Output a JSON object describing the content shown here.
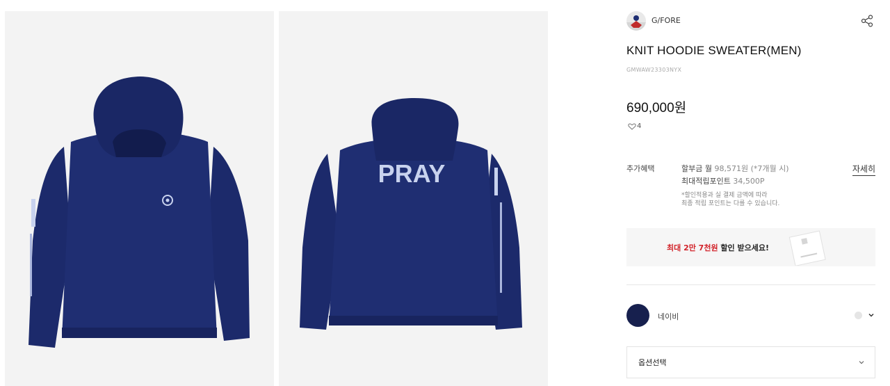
{
  "gallery": {
    "images": [
      {
        "alt": "front-view",
        "back_print": ""
      },
      {
        "alt": "back-view",
        "back_print": "PRAY"
      }
    ]
  },
  "brand": {
    "name": "G/FORE",
    "logo_icon": "brand-avatar-icon"
  },
  "share": {
    "icon": "share-icon"
  },
  "product": {
    "name": "KNIT HOODIE SWEATER(MEN)",
    "code": "GMWAW23303NYX",
    "price": "690,000원",
    "likes": "4"
  },
  "benefits": {
    "label": "추가혜택",
    "installment_prefix": "할부금 월 ",
    "installment_value": "98,571원 (*7개월 시)",
    "points_prefix": "최대적립포인트 ",
    "points_value": "34,500P",
    "note_line1": "*할인적용과 실 결제 금액에 따라",
    "note_line2": "최종 적립 포인트는 다를 수 있습니다.",
    "detail_link": "자세히"
  },
  "promo": {
    "prefix": "최대 ",
    "highlight": "2만 7천원",
    "suffix": " 할인 받으세요!"
  },
  "color_option": {
    "name": "네이비",
    "swatch": "#17204e"
  },
  "option_select": {
    "label": "옵션선택"
  },
  "colors": {
    "navy": "#1c2a6b",
    "accent_red": "#d2232a",
    "panel_bg": "#f3f3f3"
  }
}
